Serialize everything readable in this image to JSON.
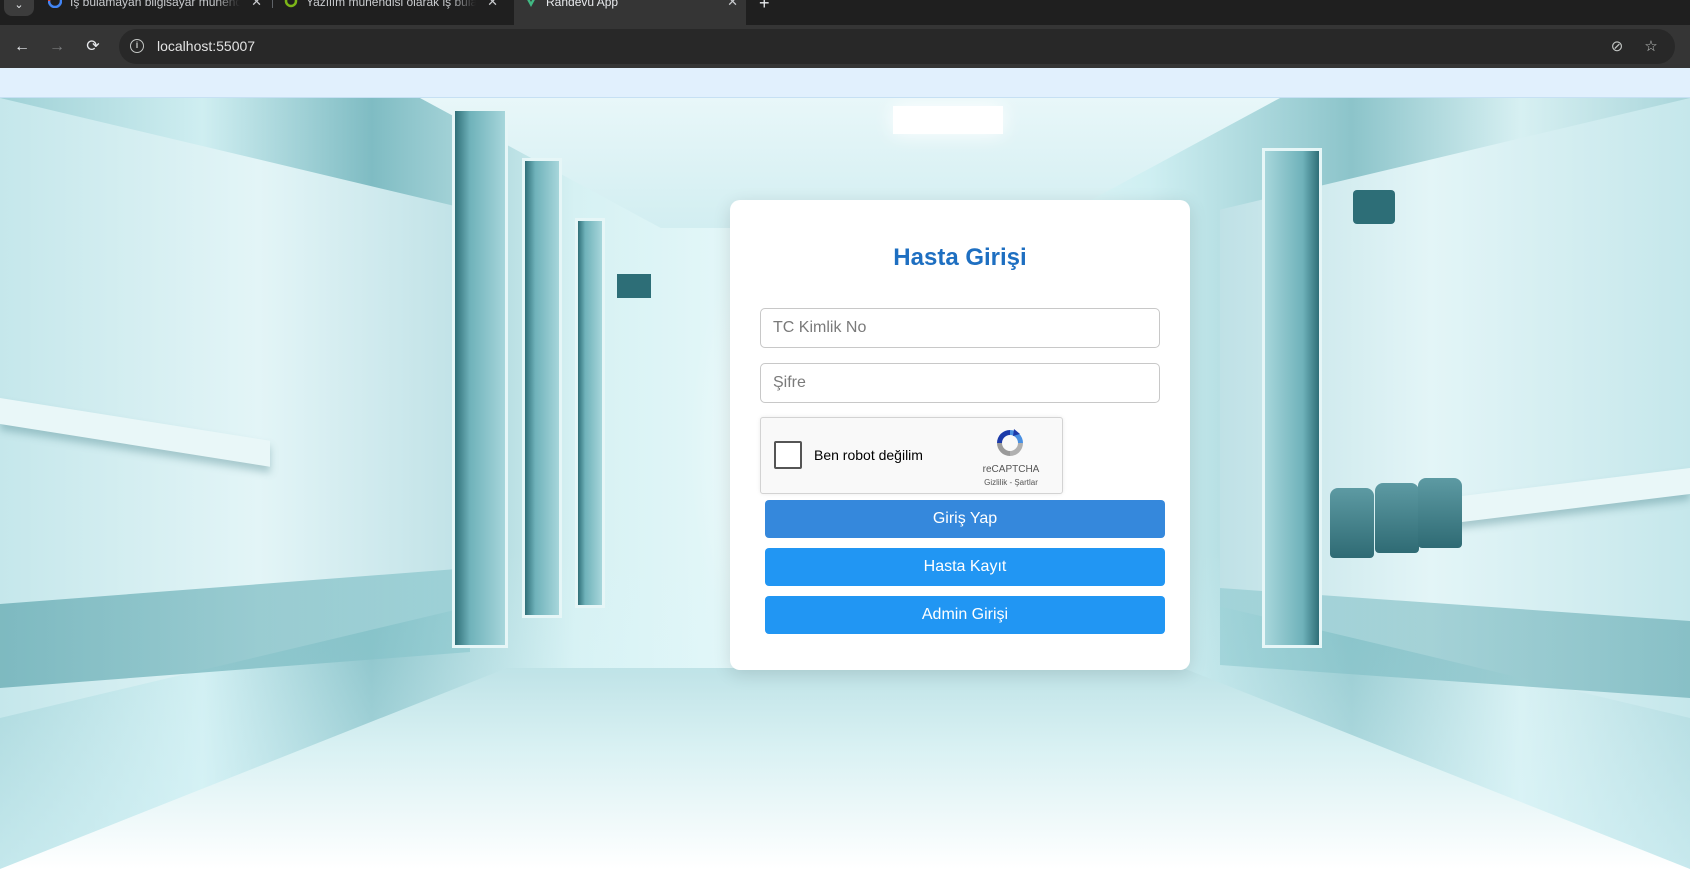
{
  "browser": {
    "tabs": [
      {
        "title": "İş bulamayan bilgisayar mühendisi",
        "active": false,
        "favicon": "google-favicon"
      },
      {
        "title": "Yazılım mühendisi olarak iş bulamamak",
        "active": false,
        "favicon": "ring-favicon"
      },
      {
        "title": "Randevu App",
        "active": true,
        "favicon": "vue-favicon"
      }
    ],
    "url": "localhost:55007",
    "icons": {
      "back": "←",
      "forward": "→",
      "reload": "⟳",
      "info": "i",
      "eye_off": "⊘",
      "star": "☆",
      "close": "✕",
      "new_tab": "+",
      "tab_menu": "⌄"
    }
  },
  "login": {
    "title": "Hasta Girişi",
    "tc_placeholder": "TC Kimlik No",
    "password_placeholder": "Şifre",
    "recaptcha": {
      "label": "Ben robot değilim",
      "brand": "reCAPTCHA",
      "terms": "Gizlilik - Şartlar"
    },
    "buttons": {
      "login": "Giriş Yap",
      "register": "Hasta Kayıt",
      "admin": "Admin Girişi"
    }
  },
  "colors": {
    "title": "#1e6fc1",
    "login_button": "#3588dc",
    "secondary_button": "#2196f3",
    "topbar": "#e1f0fd"
  }
}
